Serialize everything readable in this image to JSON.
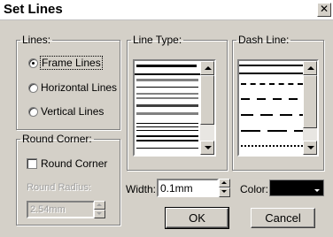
{
  "window": {
    "title": "Set Lines",
    "close_glyph": "✕"
  },
  "lines_group": {
    "label": "Lines:",
    "options": [
      {
        "label": "Frame Lines",
        "selected": true
      },
      {
        "label": "Horizontal Lines",
        "selected": false
      },
      {
        "label": "Vertical Lines",
        "selected": false
      }
    ]
  },
  "round_corner_group": {
    "label": "Round Corner:",
    "checkbox_label": "Round Corner",
    "checked": false,
    "radius_label": "Round Radius:",
    "radius_value": "2.54mm"
  },
  "line_type_group": {
    "label": "Line Type:",
    "styles": [
      "solid-thick-selected",
      "solid-gray",
      "solid-thin",
      "double-gray",
      "solid-dark",
      "triple",
      "double-bottom"
    ]
  },
  "dash_line_group": {
    "label": "Dash Line:",
    "styles": [
      "solid-selected",
      "dense-dash",
      "medium-dash",
      "long-dash",
      "dotted"
    ]
  },
  "width": {
    "label": "Width:",
    "value": "0.1mm"
  },
  "color": {
    "label": "Color:",
    "swatch": "#000000"
  },
  "buttons": {
    "ok": "OK",
    "cancel": "Cancel"
  }
}
